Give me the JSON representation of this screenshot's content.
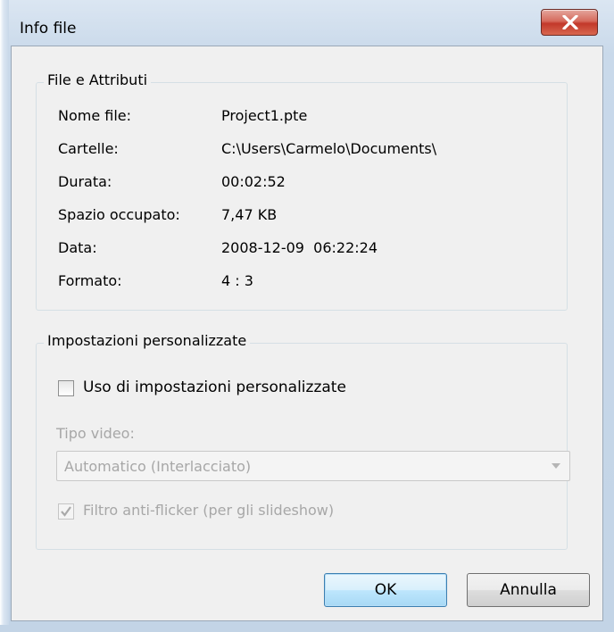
{
  "window": {
    "title": "Info file",
    "close_icon": "close-icon"
  },
  "file_group": {
    "legend": "File e Attributi",
    "rows": [
      {
        "label": "Nome file:",
        "value": "Project1.pte"
      },
      {
        "label": "Cartelle:",
        "value": "C:\\Users\\Carmelo\\Documents\\"
      },
      {
        "label": "Durata:",
        "value": "00:02:52"
      },
      {
        "label": "Spazio occupato:",
        "value": "7,47 KB"
      },
      {
        "label": "Data:",
        "value": "2008-12-09  06:22:24"
      },
      {
        "label": "Formato:",
        "value": "4 : 3"
      }
    ]
  },
  "custom_group": {
    "legend": "Impostazioni personalizzate",
    "use_custom_label": "Uso di impostazioni personalizzate",
    "use_custom_checked": false,
    "video_type_label": "Tipo video:",
    "video_type_value": "Automatico (Interlacciato)",
    "antiflicker_label": "Filtro anti-flicker (per gli slideshow)",
    "antiflicker_checked": true
  },
  "buttons": {
    "ok": "OK",
    "cancel": "Annulla"
  }
}
